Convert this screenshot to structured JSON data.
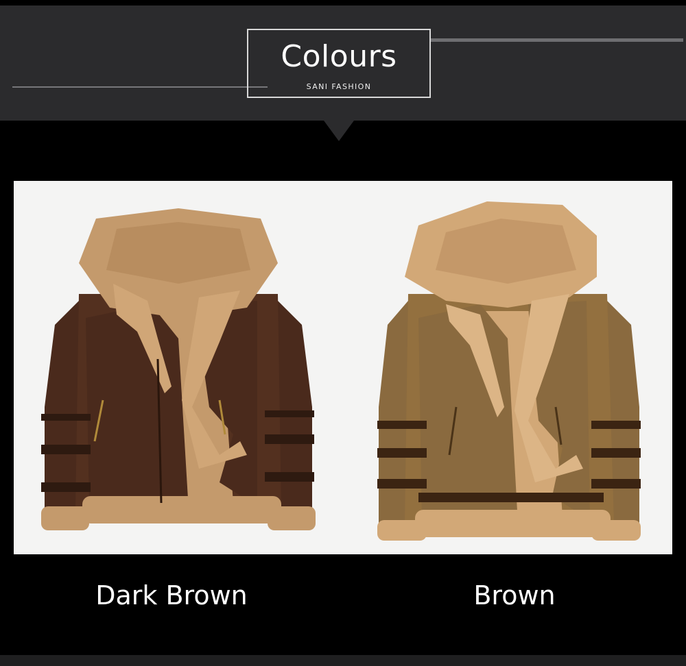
{
  "header": {
    "title": "Colours",
    "subtitle": "SANI FASHION"
  },
  "products": [
    {
      "label": "Dark Brown",
      "leather_color": "#4a2a1c",
      "fur_color": "#c49a6c",
      "image": "dark-brown-shearling-jacket"
    },
    {
      "label": "Brown",
      "leather_color": "#8a6a3f",
      "fur_color": "#d2a877",
      "image": "brown-shearling-jacket"
    }
  ],
  "colors": {
    "background": "#000000",
    "header_band": "#2b2b2d",
    "photo_background": "#f4f4f3"
  }
}
